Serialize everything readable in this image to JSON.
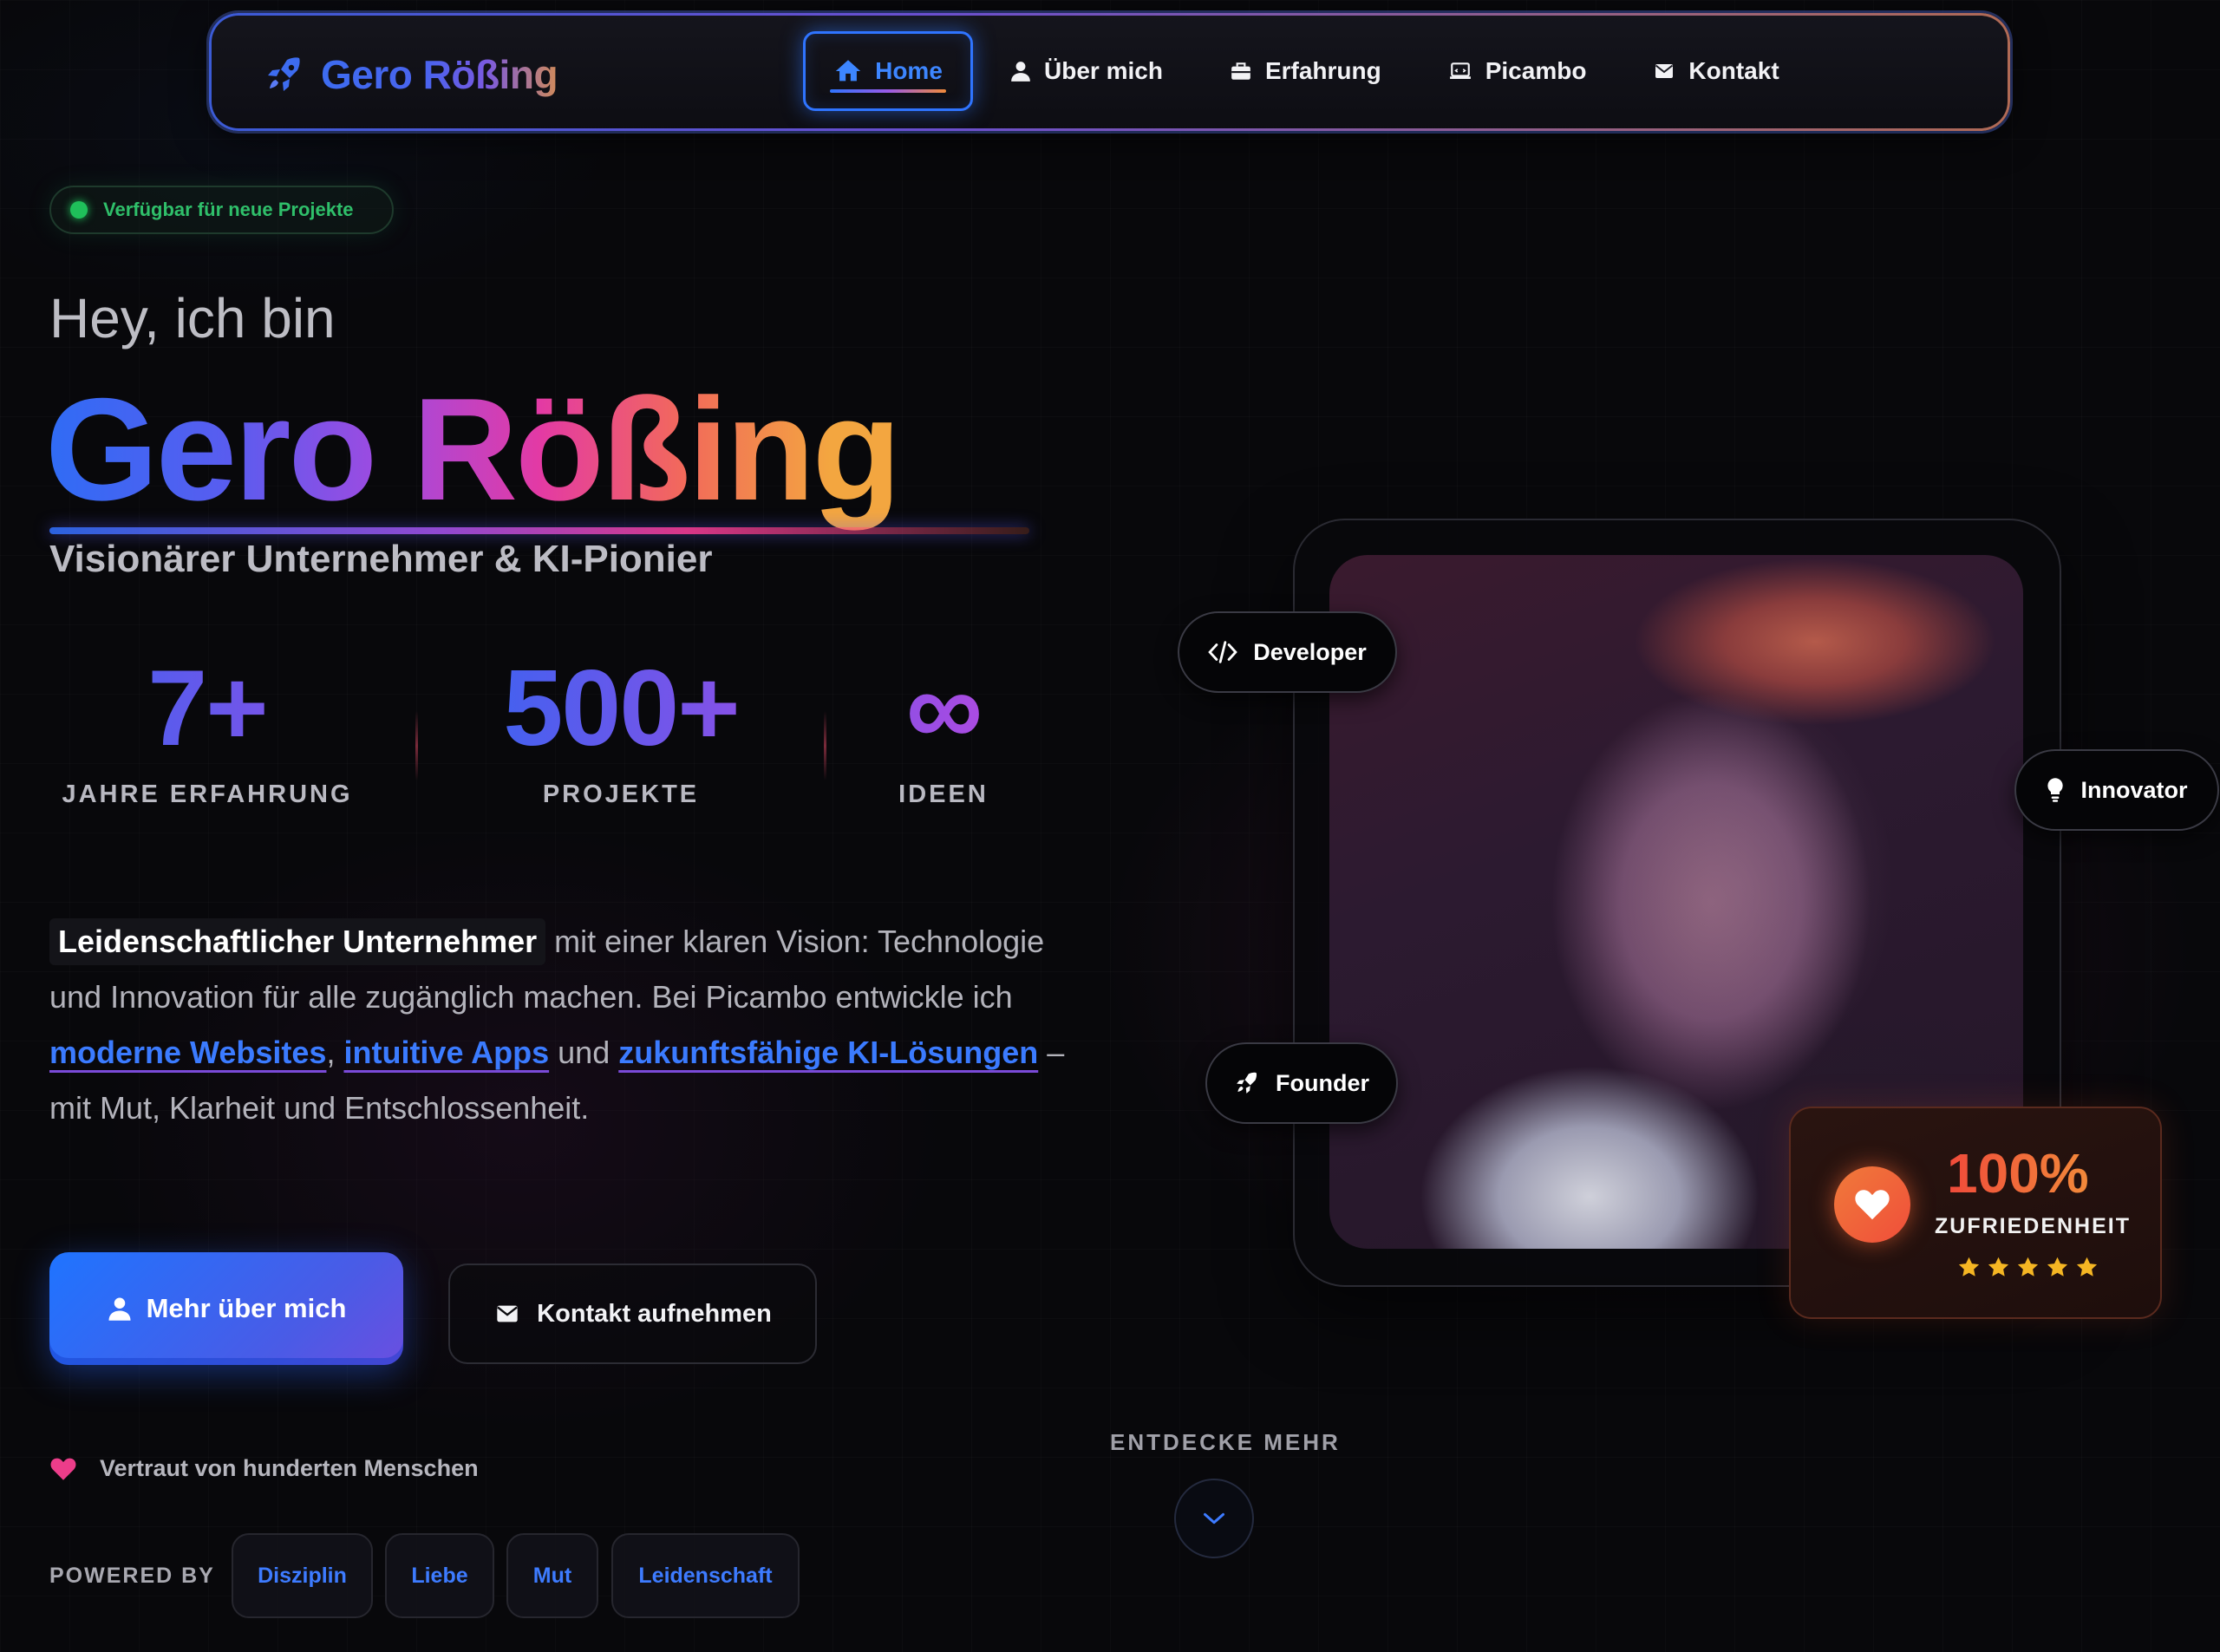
{
  "nav": {
    "brand": "Gero Rößing",
    "items": [
      {
        "label": "Home",
        "icon": "home-icon",
        "active": true
      },
      {
        "label": "Über mich",
        "icon": "user-icon",
        "active": false
      },
      {
        "label": "Erfahrung",
        "icon": "briefcase-icon",
        "active": false
      },
      {
        "label": "Picambo",
        "icon": "laptop-icon",
        "active": false
      },
      {
        "label": "Kontakt",
        "icon": "envelope-icon",
        "active": false
      }
    ]
  },
  "status": "Verfügbar für neue Projekte",
  "hero": {
    "greeting": "Hey, ich bin",
    "name": "Gero Rößing",
    "subtitle": "Visionärer Unternehmer & KI-Pionier"
  },
  "stats": [
    {
      "value": "7+",
      "label": "JAHRE ERFAHRUNG"
    },
    {
      "value": "500+",
      "label": "PROJEKTE"
    },
    {
      "value": "∞",
      "label": "IDEEN"
    }
  ],
  "intro": {
    "highlight": "Leidenschaftlicher Unternehmer",
    "text1": "mit einer klaren Vision: Technologie und Innovation für alle zugänglich machen. Bei Picambo entwickle ich",
    "link1": "moderne Websites",
    "sep1": ",",
    "link2": "intuitive Apps",
    "sep2": "und",
    "link3": "zukunftsfähige KI-Lösungen",
    "text2": "– mit Mut, Klarheit und Entschlossenheit."
  },
  "buttons": {
    "primary": "Mehr über mich",
    "secondary": "Kontakt aufnehmen"
  },
  "trust": "Vertraut von hunderten Menschen",
  "powered": {
    "label": "POWERED BY",
    "tags": [
      "Disziplin",
      "Liebe",
      "Mut",
      "Leidenschaft"
    ]
  },
  "discover": "ENTDECKE MEHR",
  "badges": {
    "developer": "Developer",
    "innovator": "Innovator",
    "founder": "Founder"
  },
  "satisfaction": {
    "value": "100%",
    "label": "ZUFRIEDENHEIT",
    "stars": 5
  },
  "colors": {
    "accent": "#2f74ff",
    "status_green": "#1fbf5a",
    "gradient_start": "#2f6cf5",
    "gradient_mid": "#e33aa4",
    "gradient_end": "#f3a640"
  }
}
